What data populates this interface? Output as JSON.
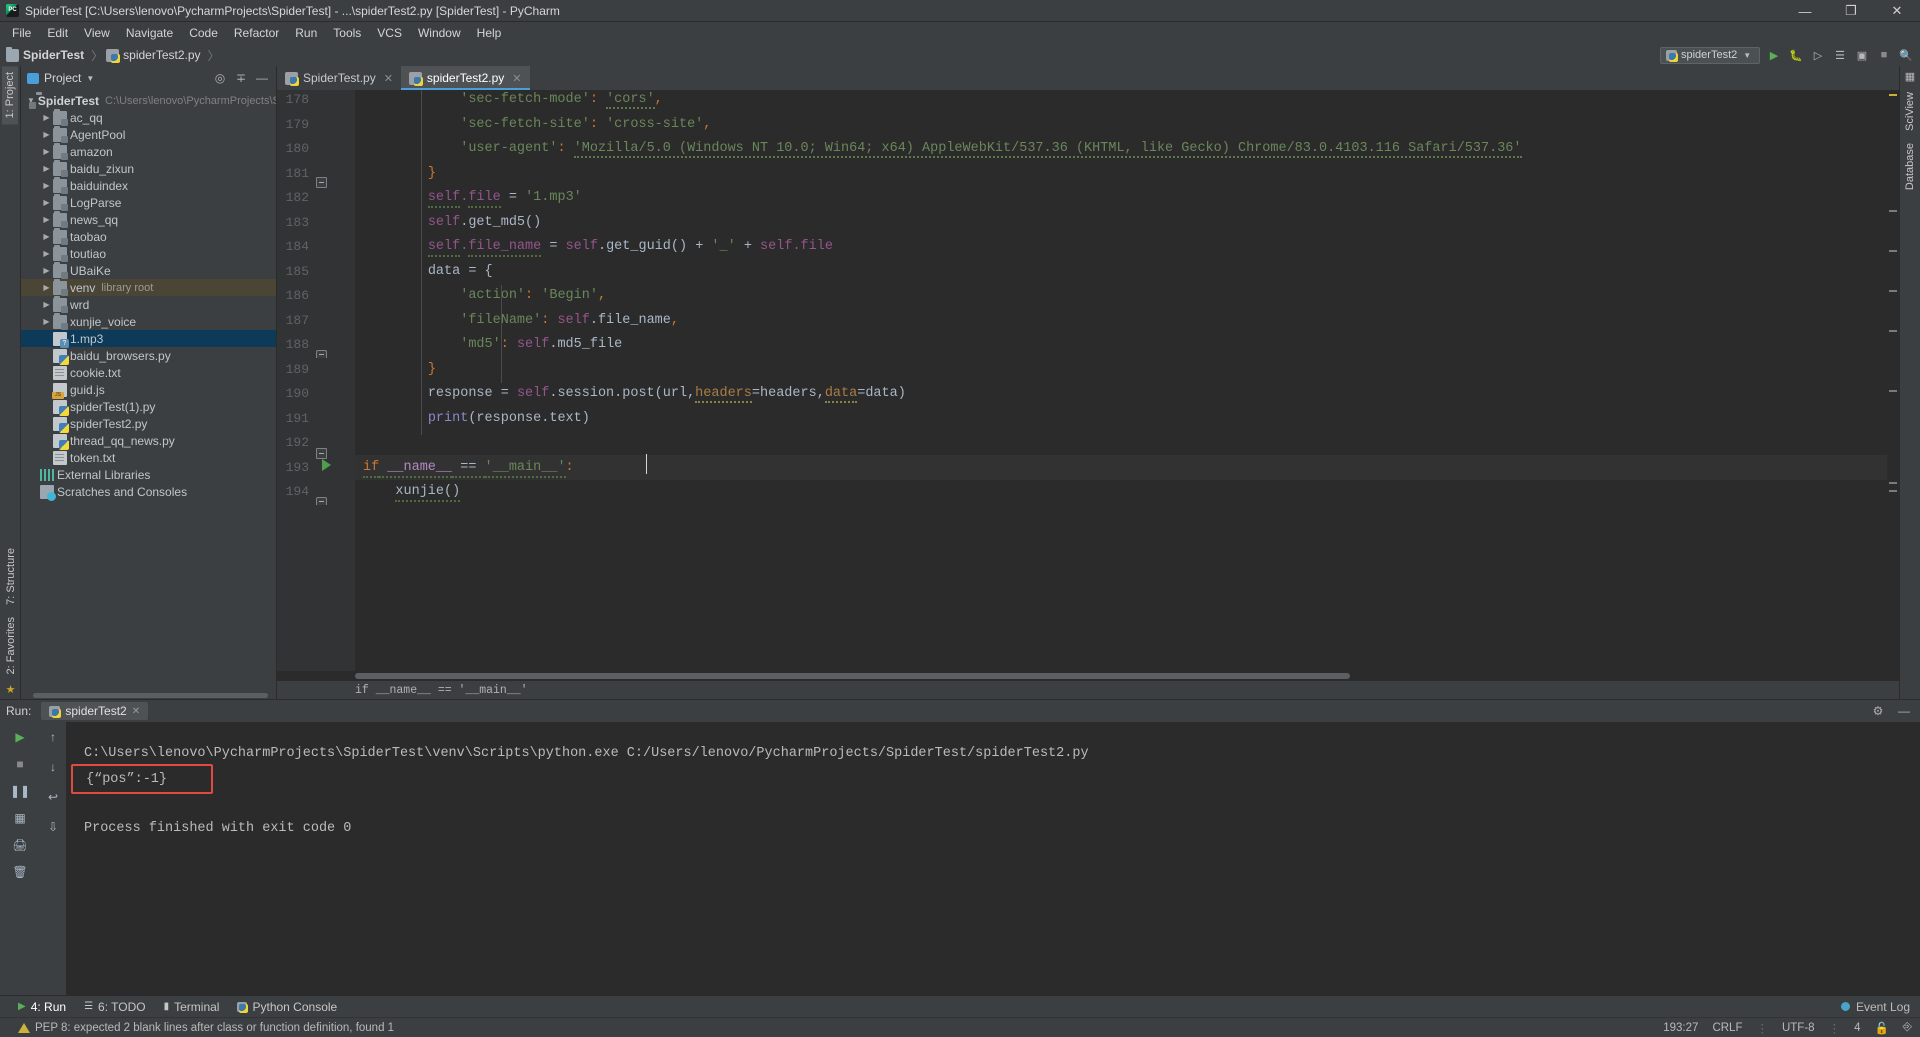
{
  "window": {
    "title": "SpiderTest [C:\\Users\\lenovo\\PycharmProjects\\SpiderTest] - ...\\spiderTest2.py [SpiderTest] - PyCharm",
    "minimize": "—",
    "maximize": "❐",
    "close": "✕"
  },
  "menu": [
    "File",
    "Edit",
    "View",
    "Navigate",
    "Code",
    "Refactor",
    "Run",
    "Tools",
    "VCS",
    "Window",
    "Help"
  ],
  "breadcrumb_nav": {
    "project": "SpiderTest",
    "file": "spiderTest2.py"
  },
  "run_toolbar": {
    "config_name": "spiderTest2",
    "run_icon": "run-icon",
    "debug_icon": "debug-icon",
    "coverage_icon": "coverage-icon",
    "profile_icon": "profile-icon",
    "stop_icon": "stop-icon",
    "search_icon": "search-icon"
  },
  "left_strip": {
    "project_tab": "1: Project",
    "structure_tab": "7: Structure",
    "favorites_tab": "2: Favorites"
  },
  "right_strip": {
    "sciview_tab": "SciView",
    "database_tab": "Database"
  },
  "project_panel": {
    "title": "Project",
    "locate_icon": "locate-icon",
    "collapse_icon": "collapse-all-icon",
    "hide_icon": "hide-icon",
    "root": {
      "name": "SpiderTest",
      "path": "C:\\Users\\lenovo\\PycharmProjects\\Spid"
    },
    "items": [
      {
        "label": "ac_qq",
        "type": "folder",
        "expandable": true
      },
      {
        "label": "AgentPool",
        "type": "folder",
        "expandable": true
      },
      {
        "label": "amazon",
        "type": "folder",
        "expandable": true
      },
      {
        "label": "baidu_zixun",
        "type": "folder",
        "expandable": true
      },
      {
        "label": "baiduindex",
        "type": "folder",
        "expandable": true
      },
      {
        "label": "LogParse",
        "type": "folder",
        "expandable": true
      },
      {
        "label": "news_qq",
        "type": "folder",
        "expandable": true
      },
      {
        "label": "taobao",
        "type": "folder",
        "expandable": true
      },
      {
        "label": "toutiao",
        "type": "folder",
        "expandable": true
      },
      {
        "label": "UBaiKe",
        "type": "folder",
        "expandable": true
      },
      {
        "label": "venv",
        "sub": "library root",
        "type": "folder",
        "expandable": true,
        "highlight": true
      },
      {
        "label": "wrd",
        "type": "folder",
        "expandable": true
      },
      {
        "label": "xunjie_voice",
        "type": "folder",
        "expandable": true
      },
      {
        "label": "1.mp3",
        "type": "mp3",
        "expandable": false,
        "selected": true
      },
      {
        "label": "baidu_browsers.py",
        "type": "py",
        "expandable": false
      },
      {
        "label": "cookie.txt",
        "type": "txt",
        "expandable": false
      },
      {
        "label": "guid.js",
        "type": "js",
        "expandable": false
      },
      {
        "label": "spiderTest(1).py",
        "type": "py",
        "expandable": false
      },
      {
        "label": "spiderTest2.py",
        "type": "py",
        "expandable": false
      },
      {
        "label": "thread_qq_news.py",
        "type": "py",
        "expandable": false
      },
      {
        "label": "token.txt",
        "type": "txt",
        "expandable": false
      },
      {
        "label": "External Libraries",
        "type": "lib",
        "expandable": false,
        "root_level": true
      },
      {
        "label": "Scratches and Consoles",
        "type": "scratch",
        "expandable": false,
        "root_level": true
      }
    ]
  },
  "editor": {
    "tabs": [
      {
        "label": "SpiderTest.py",
        "active": false,
        "icon": "python-file-icon"
      },
      {
        "label": "spiderTest2.py",
        "active": true,
        "icon": "python-file-icon"
      }
    ],
    "first_line_number": 178,
    "lines": [
      {
        "n": 178,
        "text": "            'sec-fetch-mode': 'cors',"
      },
      {
        "n": 179,
        "text": "            'sec-fetch-site': 'cross-site',"
      },
      {
        "n": 180,
        "text": "            'user-agent': 'Mozilla/5.0 (Windows NT 10.0; Win64; x64) AppleWebKit/537.36 (KHTML, like Gecko) Chrome/83.0.4103.116 Safari/537.36'"
      },
      {
        "n": 181,
        "text": "        }"
      },
      {
        "n": 182,
        "text": "        self.file = '1.mp3'"
      },
      {
        "n": 183,
        "text": "        self.get_md5()"
      },
      {
        "n": 184,
        "text": "        self.file_name = self.get_guid() + '_' + self.file"
      },
      {
        "n": 185,
        "text": "        data = {"
      },
      {
        "n": 186,
        "text": "            'action': 'Begin',"
      },
      {
        "n": 187,
        "text": "            'fileName': self.file_name,"
      },
      {
        "n": 188,
        "text": "            'md5': self.md5_file"
      },
      {
        "n": 189,
        "text": "        }"
      },
      {
        "n": 190,
        "text": "        response = self.session.post(url,headers=headers,data=data)"
      },
      {
        "n": 191,
        "text": "        print(response.text)"
      },
      {
        "n": 192,
        "text": ""
      },
      {
        "n": 193,
        "text": "if __name__ == '__main__':"
      },
      {
        "n": 194,
        "text": "    xunjie()"
      }
    ],
    "breadcrumb_status": "if __name__ == '__main__'"
  },
  "run_panel": {
    "label": "Run:",
    "tab_name": "spiderTest2",
    "settings_icon": "gear-icon",
    "minimize_icon": "minimize-icon",
    "close_icon": "close-icon",
    "tools": [
      "rerun-icon",
      "stop-icon",
      "pause-icon",
      "up-icon",
      "down-icon",
      "wrap-icon",
      "print-icon",
      "trash-icon",
      "layout-icon",
      "export-icon"
    ],
    "output": [
      "C:\\Users\\lenovo\\PycharmProjects\\SpiderTest\\venv\\Scripts\\python.exe C:/Users/lenovo/PycharmProjects/SpiderTest/spiderTest2.py",
      "{“pos”:-1}",
      "",
      "Process finished with exit code 0"
    ],
    "highlighted_line_index": 1,
    "highlight_color": "#e04a3f"
  },
  "bottom_toolbar": {
    "items": [
      {
        "label": "4: Run",
        "icon": "run-icon",
        "active": true
      },
      {
        "label": "6: TODO",
        "icon": "todo-icon",
        "active": false
      },
      {
        "label": "Terminal",
        "icon": "terminal-icon",
        "active": false
      },
      {
        "label": "Python Console",
        "icon": "python-console-icon",
        "active": false
      }
    ],
    "event_log": "Event Log"
  },
  "status_bar": {
    "message": "PEP 8: expected 2 blank lines after class or function definition, found 1",
    "caret_position": "193:27",
    "line_separator": "CRLF",
    "encoding": "UTF-8",
    "indent": "4",
    "lock_icon": "lock-icon",
    "branch_icon": "branch-icon"
  }
}
